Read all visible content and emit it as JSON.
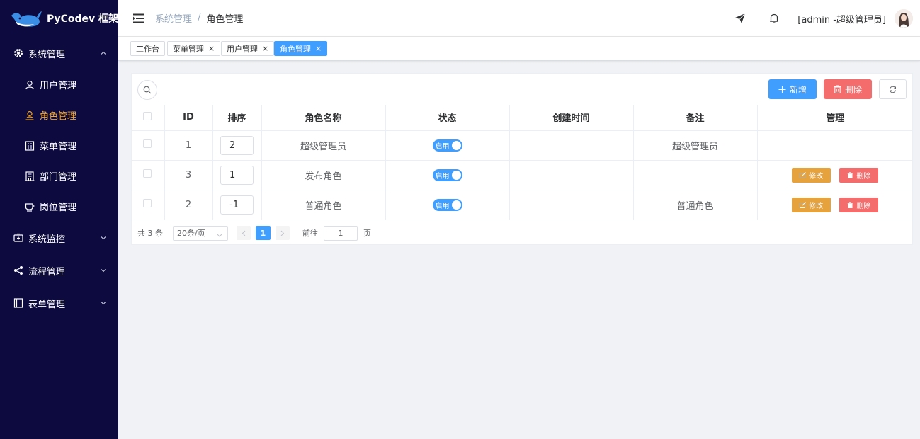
{
  "app": {
    "title": "PyCodev 框架"
  },
  "sidebar": {
    "groups": [
      {
        "label": "系统管理",
        "icon": "gear-icon",
        "expanded": true,
        "items": [
          {
            "label": "用户管理",
            "icon": "user-icon",
            "active": false
          },
          {
            "label": "角色管理",
            "icon": "role-icon",
            "active": true
          },
          {
            "label": "菜单管理",
            "icon": "menu-icon",
            "active": false
          },
          {
            "label": "部门管理",
            "icon": "building-icon",
            "active": false
          },
          {
            "label": "岗位管理",
            "icon": "cup-icon",
            "active": false
          }
        ]
      },
      {
        "label": "系统监控",
        "icon": "monitor-icon",
        "expanded": false
      },
      {
        "label": "流程管理",
        "icon": "share-icon",
        "expanded": false
      },
      {
        "label": "表单管理",
        "icon": "form-icon",
        "expanded": false
      }
    ]
  },
  "header": {
    "breadcrumb": [
      "系统管理",
      "角色管理"
    ],
    "breadcrumb_sep": "/",
    "user_label": "[admin -超级管理员]"
  },
  "tags": [
    {
      "label": "工作台",
      "closable": false,
      "active": false
    },
    {
      "label": "菜单管理",
      "closable": true,
      "active": false
    },
    {
      "label": "用户管理",
      "closable": true,
      "active": false
    },
    {
      "label": "角色管理",
      "closable": true,
      "active": true
    }
  ],
  "tag_close": "×",
  "toolbar": {
    "add_label": "新增",
    "delete_label": "删除"
  },
  "table": {
    "columns": [
      "",
      "ID",
      "排序",
      "角色名称",
      "状态",
      "创建时间",
      "备注",
      "管理"
    ],
    "rows": [
      {
        "id": "1",
        "sort": "2",
        "name": "超级管理员",
        "status": "启用",
        "created": "",
        "remark": "超级管理员",
        "actions": false
      },
      {
        "id": "3",
        "sort": "1",
        "name": "发布角色",
        "status": "启用",
        "created": "",
        "remark": "",
        "actions": true
      },
      {
        "id": "2",
        "sort": "-1",
        "name": "普通角色",
        "status": "启用",
        "created": "",
        "remark": "普通角色",
        "actions": true
      }
    ],
    "edit_label": "修改",
    "remove_label": "删除"
  },
  "pager": {
    "total": "共 3 条",
    "page_size": "20条/页",
    "current": "1",
    "goto_label": "前往",
    "goto_value": "1",
    "page_unit": "页"
  },
  "colors": {
    "sidebar_bg": "#0c0a3e",
    "primary": "#409eff",
    "danger": "#f56c6c",
    "warning": "#e6a23c",
    "active_menu": "#f5a623"
  }
}
